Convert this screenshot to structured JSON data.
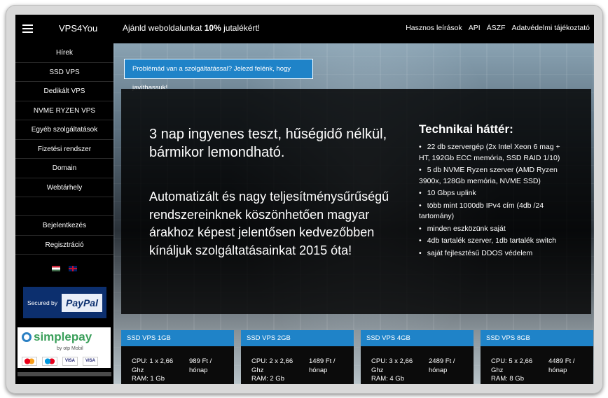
{
  "brand": "VPS4You",
  "promo": {
    "prefix": "Ajánld weboldalunkat ",
    "highlight": "10%",
    "suffix": " jutalékért!"
  },
  "topnav": [
    "Hasznos leírások",
    "API",
    "ÁSZF",
    "Adatvédelmi tájékoztató"
  ],
  "sidebar": {
    "items": [
      "Hírek",
      "SSD VPS",
      "Dedikált VPS",
      "NVME RYZEN VPS",
      "Egyéb szolgáltatások",
      "Fizetési rendszer",
      "Domain",
      "Webtárhely"
    ],
    "account": [
      "Bejelentkezés",
      "Regisztráció"
    ]
  },
  "payment": {
    "paypal_secured": "Secured by",
    "paypal_logo": "PayPal",
    "simplepay_logo": "simplepay",
    "simplepay_by": "by otp Mobil",
    "cards": [
      "",
      "",
      "VISA",
      "VISA"
    ]
  },
  "report_button": "Problémád van a szolgáltatással? Jelezd felénk, hogy javíthassuk!",
  "hero": {
    "headline": "3 nap ingyenes teszt, hűségidő nélkül, bármikor lemondható.",
    "subline": "Automatizált és nagy teljesítménysűrűségű rendszereinknek köszönhetően magyar árakhoz képest jelentősen kedvezőbben kínáljuk szolgáltatásainkat 2015 óta!"
  },
  "tech": {
    "title": "Technikai háttér:",
    "items": [
      "22 db szervergép (2x Intel Xeon 6 mag + HT, 192Gb ECC memória, SSD RAID 1/10)",
      "5 db NVME Ryzen szerver (AMD Ryzen 3900x, 128Gb memória, NVME SSD)",
      "10 Gbps uplink",
      "több mint 1000db IPv4 cím (4db /24 tartomány)",
      "minden eszközünk saját",
      "4db tartalék szerver, 1db tartalék switch",
      "saját fejlesztésű DDOS védelem"
    ]
  },
  "products": [
    {
      "name": "SSD VPS 1GB",
      "cpu": "CPU: 1 x 2,66 Ghz",
      "price": "989 Ft / hónap",
      "ram": "RAM: 1 Gb"
    },
    {
      "name": "SSD VPS 2GB",
      "cpu": "CPU: 2 x 2,66 Ghz",
      "price": "1489 Ft / hónap",
      "ram": "RAM: 2 Gb"
    },
    {
      "name": "SSD VPS 4GB",
      "cpu": "CPU: 3 x 2,66 Ghz",
      "price": "2489 Ft / hónap",
      "ram": "RAM: 4 Gb"
    },
    {
      "name": "SSD VPS 8GB",
      "cpu": "CPU: 5 x 2,66 Ghz",
      "price": "4489 Ft / hónap",
      "ram": "RAM: 8 Gb"
    }
  ]
}
